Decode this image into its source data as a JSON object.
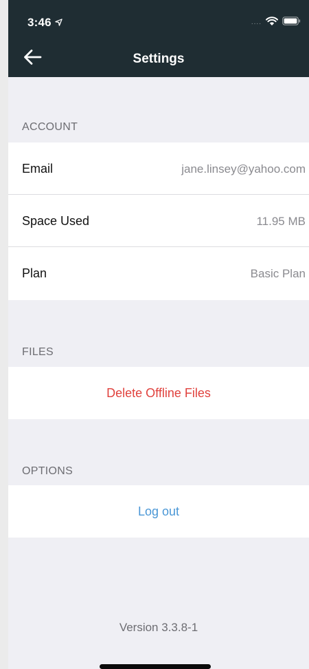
{
  "status_bar": {
    "time": "3:46",
    "signal_dots": "....",
    "icons": [
      "location-arrow-icon",
      "wifi-icon",
      "battery-icon"
    ]
  },
  "navbar": {
    "title": "Settings",
    "back_icon": "arrow-left-icon"
  },
  "sections": {
    "account": {
      "header": "ACCOUNT",
      "rows": [
        {
          "label": "Email",
          "value": "jane.linsey@yahoo.com"
        },
        {
          "label": "Space Used",
          "value": "11.95 MB"
        },
        {
          "label": "Plan",
          "value": "Basic Plan"
        }
      ]
    },
    "files": {
      "header": "FILES",
      "action_label": "Delete Offline Files"
    },
    "options": {
      "header": "OPTIONS",
      "action_label": "Log out"
    }
  },
  "footer": {
    "version": "Version 3.3.8-1"
  },
  "colors": {
    "navbar_bg": "#1f2d33",
    "background": "#efeff4",
    "destructive": "#e0413d",
    "link": "#4a97d6",
    "secondary_text": "#8a8a8f"
  }
}
